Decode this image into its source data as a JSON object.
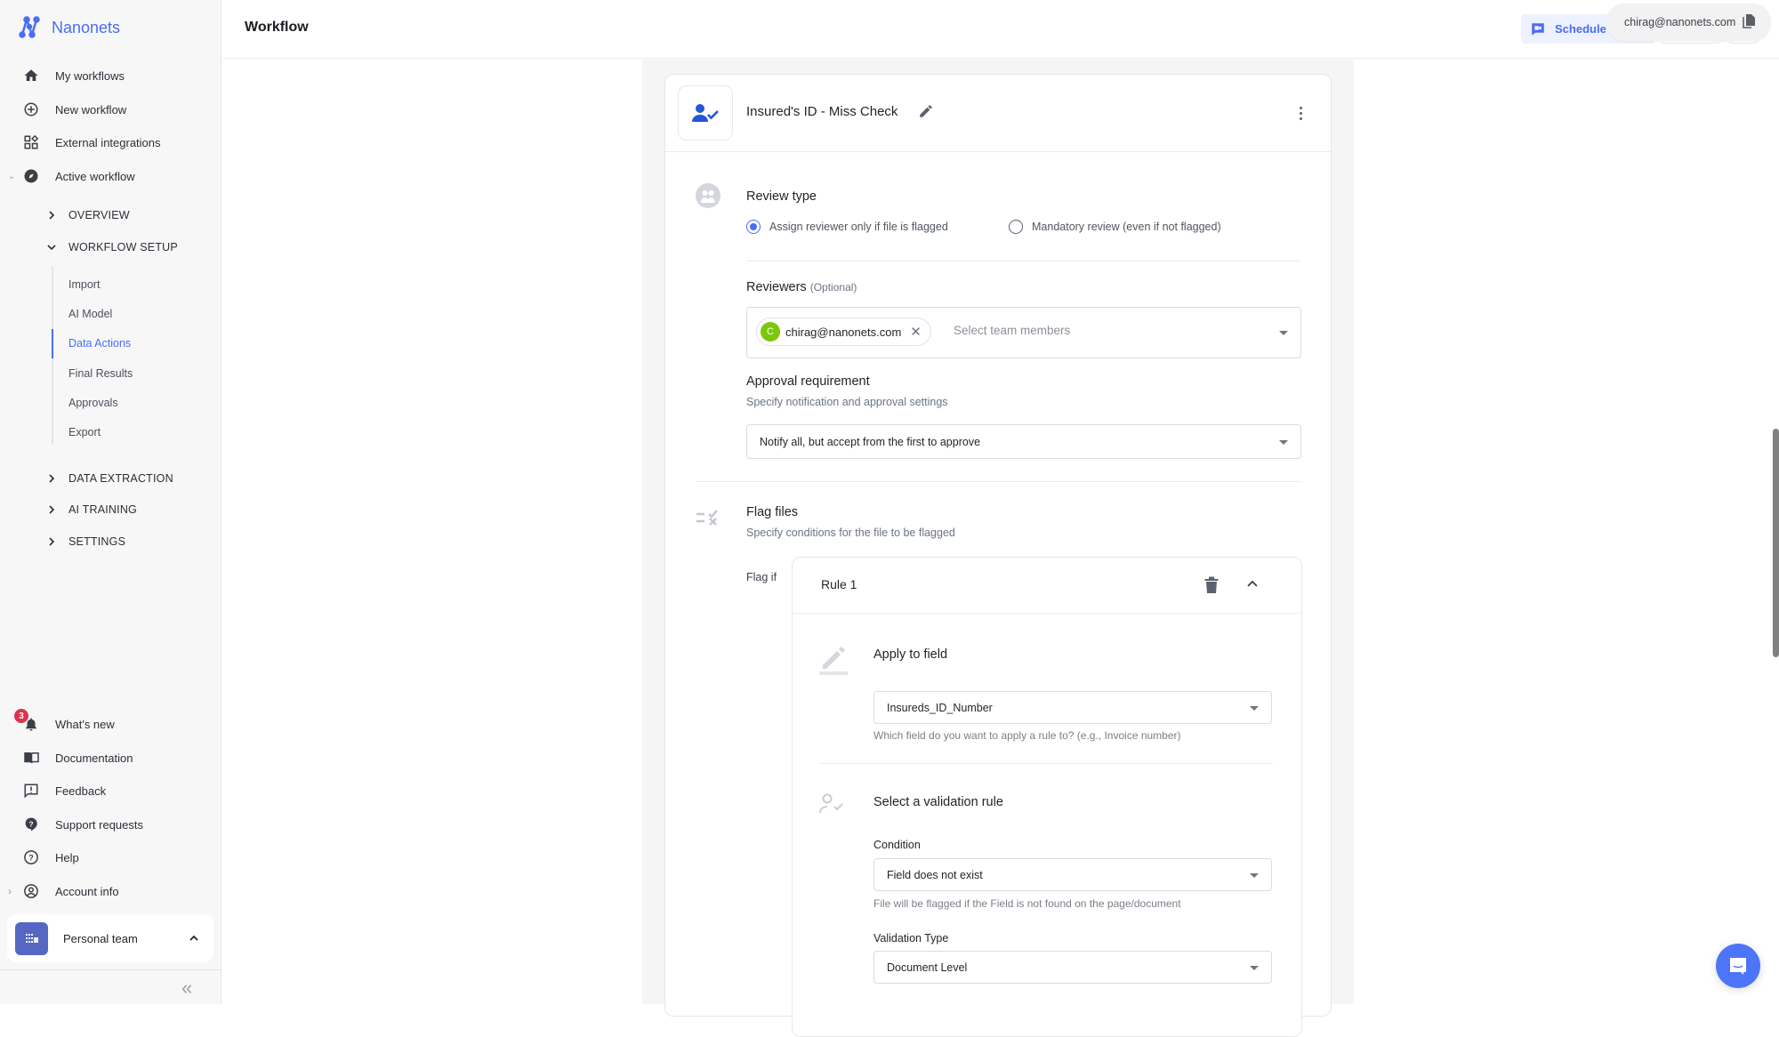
{
  "brand": {
    "name": "Nanonets",
    "accent": "#4a6cf7"
  },
  "sidebar": {
    "main_items": [
      {
        "label": "My workflows",
        "icon": "home-icon"
      },
      {
        "label": "New workflow",
        "icon": "plus-circle-icon"
      },
      {
        "label": "External integrations",
        "icon": "widgets-icon"
      },
      {
        "label": "Active workflow",
        "icon": "compass-icon",
        "expanded": true
      }
    ],
    "sections": [
      {
        "label": "OVERVIEW",
        "expanded": false
      },
      {
        "label": "WORKFLOW SETUP",
        "expanded": true
      },
      {
        "label": "DATA EXTRACTION",
        "expanded": false
      },
      {
        "label": "AI TRAINING",
        "expanded": false
      },
      {
        "label": "SETTINGS",
        "expanded": false
      }
    ],
    "workflow_setup_items": [
      {
        "label": "Import",
        "active": false
      },
      {
        "label": "AI Model",
        "active": false
      },
      {
        "label": "Data Actions",
        "active": true
      },
      {
        "label": "Final Results",
        "active": false
      },
      {
        "label": "Approvals",
        "active": false
      },
      {
        "label": "Export",
        "active": false
      }
    ],
    "bottom_items": [
      {
        "label": "What's new",
        "icon": "bell-icon",
        "badge": "3"
      },
      {
        "label": "Documentation",
        "icon": "book-icon"
      },
      {
        "label": "Feedback",
        "icon": "feedback-icon"
      },
      {
        "label": "Support requests",
        "icon": "help-bubble-icon"
      },
      {
        "label": "Help",
        "icon": "help-circle-icon"
      },
      {
        "label": "Account info",
        "icon": "account-circle-icon"
      }
    ],
    "team": {
      "name": "Personal team"
    }
  },
  "header": {
    "title": "Workflow",
    "schedule_label": "Schedule a",
    "email_tooltip": "chirag@nanonets.com"
  },
  "card": {
    "title": "Insured's ID - Miss Check",
    "review_type": {
      "label": "Review type",
      "options": [
        {
          "label": "Assign reviewer only if file is flagged",
          "checked": true
        },
        {
          "label": "Mandatory review (even if not flagged)",
          "checked": false
        }
      ]
    },
    "reviewers": {
      "label": "Reviewers",
      "optional": "(Optional)",
      "chips": [
        {
          "initial": "C",
          "email": "chirag@nanonets.com"
        }
      ],
      "placeholder": "Select team members"
    },
    "approval": {
      "label": "Approval requirement",
      "sub": "Specify notification and approval settings",
      "value": "Notify all, but accept from the first to approve"
    },
    "flag_files": {
      "label": "Flag files",
      "sub": "Specify conditions for the file to be flagged",
      "flag_if": "Flag if",
      "rule": {
        "title": "Rule 1",
        "apply_field": {
          "label": "Apply to field",
          "value": "Insureds_ID_Number",
          "hint": "Which field do you want to apply a rule to? (e.g., Invoice number)"
        },
        "validation": {
          "label": "Select a validation rule",
          "condition_label": "Condition",
          "condition_value": "Field does not exist",
          "condition_hint": "File will be flagged if the Field is not found on the page/document",
          "type_label": "Validation Type",
          "type_value": "Document Level"
        }
      }
    }
  }
}
